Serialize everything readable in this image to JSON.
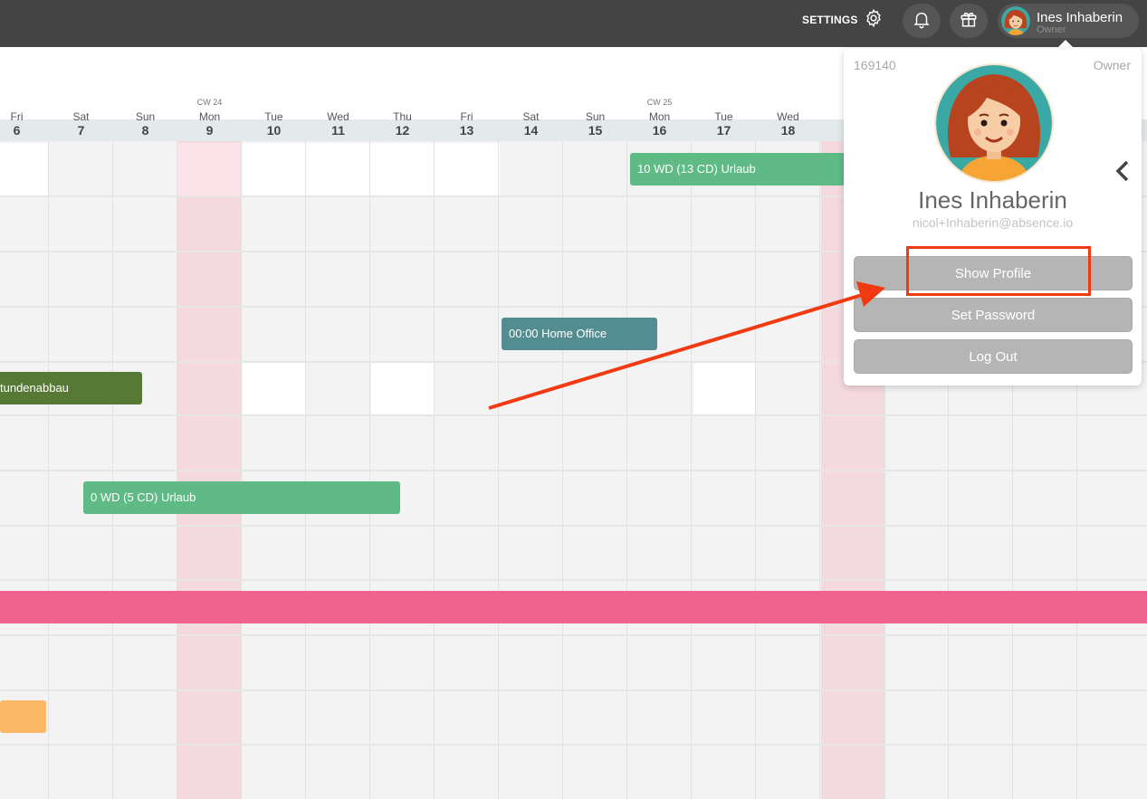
{
  "topbar": {
    "settings_label": "SETTINGS",
    "user_name": "Ines Inhaberin",
    "user_role": "Owner"
  },
  "calendar": {
    "days": [
      {
        "cw": "",
        "name": "Fri",
        "num": "6"
      },
      {
        "cw": "",
        "name": "Sat",
        "num": "7"
      },
      {
        "cw": "",
        "name": "Sun",
        "num": "8"
      },
      {
        "cw": "CW 24",
        "name": "Mon",
        "num": "9"
      },
      {
        "cw": "",
        "name": "Tue",
        "num": "10"
      },
      {
        "cw": "",
        "name": "Wed",
        "num": "11"
      },
      {
        "cw": "",
        "name": "Thu",
        "num": "12"
      },
      {
        "cw": "",
        "name": "Fri",
        "num": "13"
      },
      {
        "cw": "",
        "name": "Sat",
        "num": "14"
      },
      {
        "cw": "",
        "name": "Sun",
        "num": "15"
      },
      {
        "cw": "CW 25",
        "name": "Mon",
        "num": "16"
      },
      {
        "cw": "",
        "name": "Tue",
        "num": "17"
      },
      {
        "cw": "",
        "name": "Wed",
        "num": "18"
      }
    ],
    "events": [
      {
        "label": "10 WD (13 CD) Urlaub",
        "color": "#5fba86"
      },
      {
        "label": "00:00 Home Office",
        "color": "#548d91"
      },
      {
        "label": "tundenabbau",
        "color": "#567a36"
      },
      {
        "label": "0 WD (5 CD) Urlaub",
        "color": "#5fba86"
      },
      {
        "label": "",
        "color": "#f0628f"
      },
      {
        "label": "",
        "color": "#fcb866"
      }
    ],
    "holiday_color": "#f4d9df"
  },
  "popup": {
    "user_id": "169140",
    "role": "Owner",
    "name": "Ines Inhaberin",
    "email": "nicol+Inhaberin@absence.io",
    "show_profile": "Show Profile",
    "set_password": "Set Password",
    "log_out": "Log Out"
  },
  "icons": {
    "settings": "gear-icon",
    "notifications": "bell-icon",
    "gifts": "gift-icon",
    "collapse": "chevron-left-icon"
  },
  "annotation_color": "#f23a12"
}
